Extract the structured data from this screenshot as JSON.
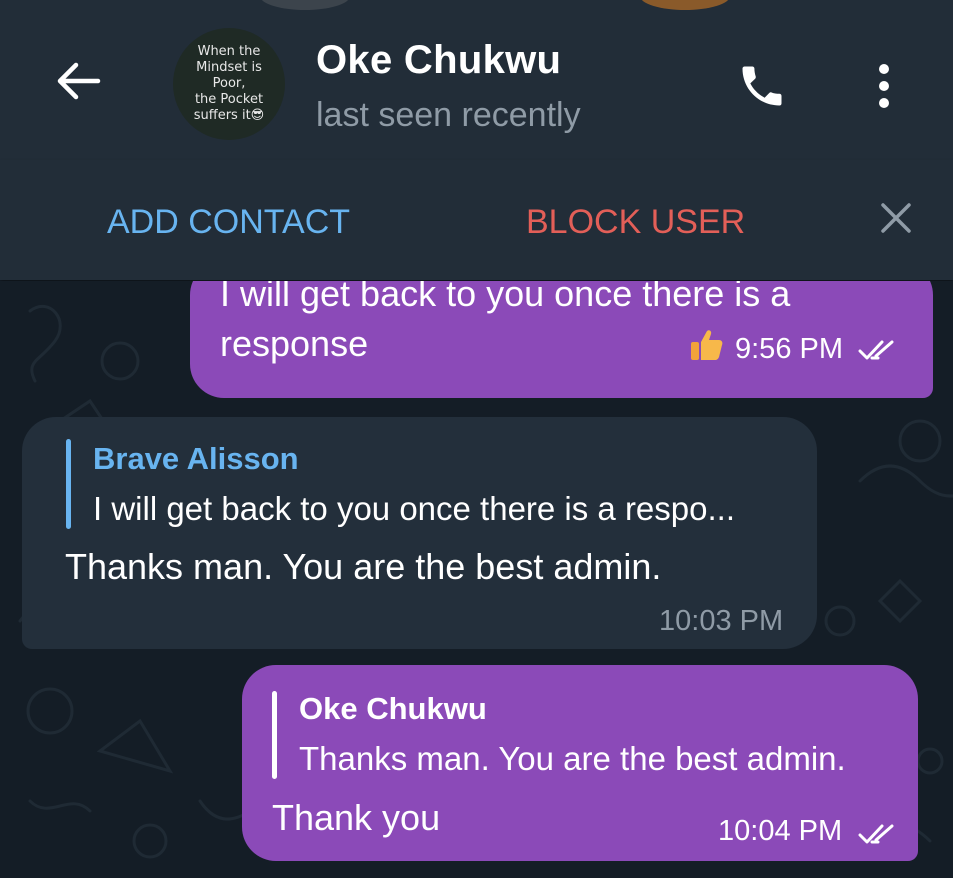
{
  "header": {
    "back_icon": "arrow-left-icon",
    "avatar_lines": [
      "When the",
      "Mindset is",
      "Poor,",
      "the Pocket",
      "suffers it😎"
    ],
    "contact_name": "Oke Chukwu",
    "status": "last seen recently",
    "call_icon": "phone-icon",
    "menu_icon": "more-vertical-icon"
  },
  "action_bar": {
    "add_contact": "ADD CONTACT",
    "block_user": "BLOCK USER",
    "close_icon": "close-icon",
    "add_color": "#68b4f0",
    "block_color": "#e35f58"
  },
  "messages": [
    {
      "direction": "outgoing",
      "text": "I will get back to you once there is a response",
      "reaction": "👍",
      "time": "9:56 PM",
      "read": true
    },
    {
      "direction": "incoming",
      "reply_to": {
        "name": "Brave Alisson",
        "text": "I will get back to you once there is a respo..."
      },
      "text": "Thanks man. You are the best admin.",
      "time": "10:03 PM"
    },
    {
      "direction": "outgoing",
      "reply_to": {
        "name": "Oke Chukwu",
        "text": "Thanks man. You are the best admin."
      },
      "text": "Thank you",
      "time": "10:04 PM",
      "read": true
    }
  ],
  "colors": {
    "outgoing_bubble": "#8b4ab8",
    "incoming_bubble": "#232f3b",
    "header_bg": "#222d38",
    "chat_bg": "#141d26"
  }
}
